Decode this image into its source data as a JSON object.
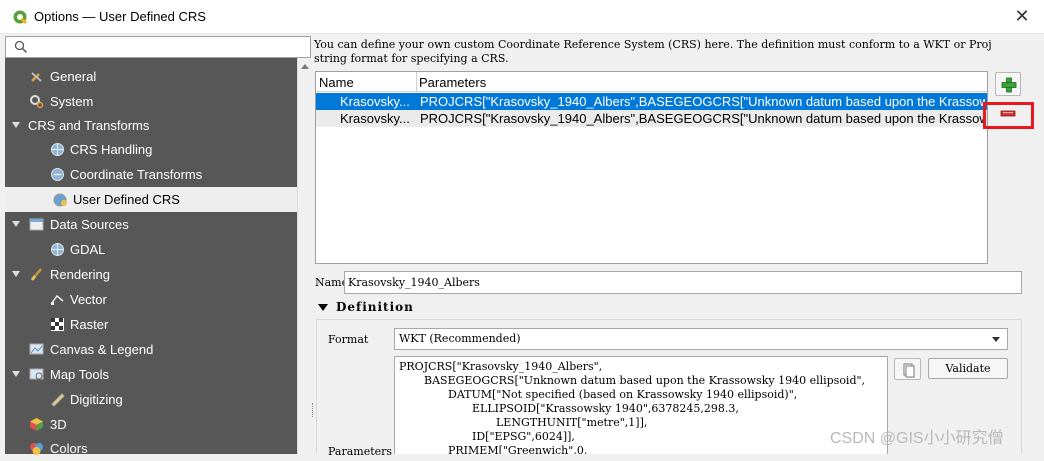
{
  "window": {
    "title": "Options — User Defined CRS",
    "close_glyph": "✕"
  },
  "search": {
    "placeholder": ""
  },
  "sidebar": {
    "items": [
      {
        "label": "General",
        "icon": "wrench-icon"
      },
      {
        "label": "System",
        "icon": "gears-icon"
      },
      {
        "label": "CRS and Transforms",
        "icon": ""
      },
      {
        "label": "CRS Handling",
        "icon": "globe-icon"
      },
      {
        "label": "Coordinate Transforms",
        "icon": "globe-transform-icon"
      },
      {
        "label": "User Defined CRS",
        "icon": "user-globe-icon"
      },
      {
        "label": "Data Sources",
        "icon": "table-icon"
      },
      {
        "label": "GDAL",
        "icon": "globe-icon"
      },
      {
        "label": "Rendering",
        "icon": "paintbrush-icon"
      },
      {
        "label": "Vector",
        "icon": "vector-icon"
      },
      {
        "label": "Raster",
        "icon": "checker-icon"
      },
      {
        "label": "Canvas & Legend",
        "icon": "canvas-icon"
      },
      {
        "label": "Map Tools",
        "icon": "map-tools-icon"
      },
      {
        "label": "Digitizing",
        "icon": "digitizing-icon"
      },
      {
        "label": "3D",
        "icon": "cube-icon"
      },
      {
        "label": "Colors",
        "icon": "colors-icon"
      }
    ],
    "selected": "User Defined CRS"
  },
  "main": {
    "description": "You can define your own custom Coordinate Reference System (CRS) here. The definition must conform to a WKT or Proj string format for specifying a CRS.",
    "table": {
      "columns": [
        "Name",
        "Parameters"
      ],
      "rows": [
        {
          "name": "Krasovsky...",
          "params": "PROJCRS[\"Krasovsky_1940_Albers\",BASEGEOGCRS[\"Unknown datum based upon the Krassows...",
          "selected": true
        },
        {
          "name": "Krasovsky...",
          "params": "PROJCRS[\"Krasovsky_1940_Albers\",BASEGEOGCRS[\"Unknown datum based upon the Krassows...",
          "selected": false
        }
      ]
    },
    "name_label": "Name",
    "name_value": "Krasovsky_1940_Albers",
    "definition_label": "Definition",
    "format_label": "Format",
    "format_value": "WKT (Recommended)",
    "wkt_lines": [
      "PROJCRS[\"Krasovsky_1940_Albers\",",
      "BASEGEOGCRS[\"Unknown datum based upon the Krassowsky 1940 ellipsoid\",",
      "DATUM[\"Not specified (based on Krassowsky 1940 ellipsoid)\",",
      "ELLIPSOID[\"Krassowsky 1940\",6378245,298.3,",
      "LENGTHUNIT[\"metre\",1]],",
      "ID[\"EPSG\",6024]],",
      "PRIMEM[\"Greenwich\",0,"
    ],
    "validate_label": "Validate",
    "parameters_label": "Parameters"
  },
  "watermark": "CSDN @GIS小小研究僧",
  "colors": {
    "sidebar_bg": "#575757",
    "selection": "#0078d7",
    "highlight": "#e8181f",
    "add_green": "#3aa23a",
    "remove_red": "#d9302f"
  }
}
